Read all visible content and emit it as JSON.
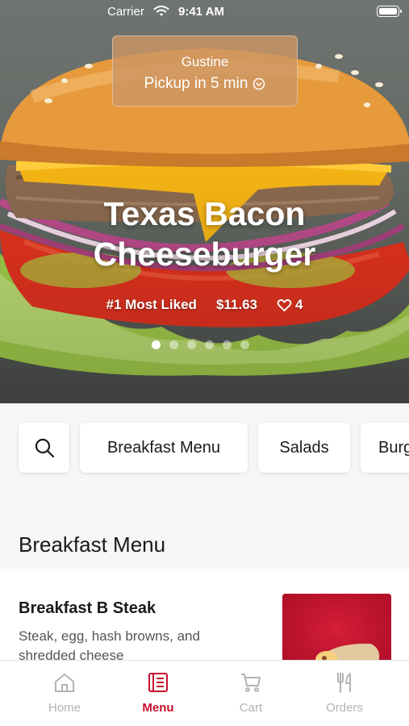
{
  "status_bar": {
    "carrier": "Carrier",
    "time": "9:41 AM"
  },
  "pickup": {
    "store": "Gustine",
    "eta": "Pickup in 5 min"
  },
  "hero": {
    "title_line1": "Texas Bacon",
    "title_line2": "Cheeseburger",
    "tag": "#1 Most Liked",
    "price": "$11.63",
    "likes": "4",
    "slide_count": 6,
    "active_slide": 1
  },
  "categories": {
    "search_icon": "search-icon",
    "items": [
      "Breakfast Menu",
      "Salads",
      "Burg"
    ]
  },
  "section": {
    "title": "Breakfast Menu"
  },
  "menu_item": {
    "name": "Breakfast B Steak",
    "description": "Steak, egg, hash browns, and shredded cheese"
  },
  "tabs": [
    {
      "label": "Home",
      "icon": "home-icon"
    },
    {
      "label": "Menu",
      "icon": "menu-icon",
      "active": true
    },
    {
      "label": "Cart",
      "icon": "cart-icon"
    },
    {
      "label": "Orders",
      "icon": "fork-knife-icon"
    }
  ],
  "colors": {
    "accent": "#c8102e",
    "inactive": "#b3b3b3"
  }
}
